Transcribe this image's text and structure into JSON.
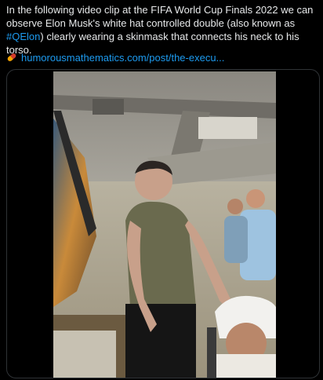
{
  "post": {
    "text_before_hashtag": "In the following video clip at the FIFA World Cup Finals 2022 we can observe Elon Musk's white hat controlled double (also known as ",
    "hashtag": "#QElon",
    "text_after_hashtag": ") clearly wearing a skinmask that connects his neck to his torso."
  },
  "link": {
    "icon": "pill-icon",
    "text": "humorousmathematics.com/post/the-execu..."
  },
  "media": {
    "type": "video",
    "icon": "video-thumbnail"
  },
  "colors": {
    "background": "#000000",
    "text": "#e7e9ea",
    "link": "#1d9bf0",
    "border": "#2f3336"
  }
}
